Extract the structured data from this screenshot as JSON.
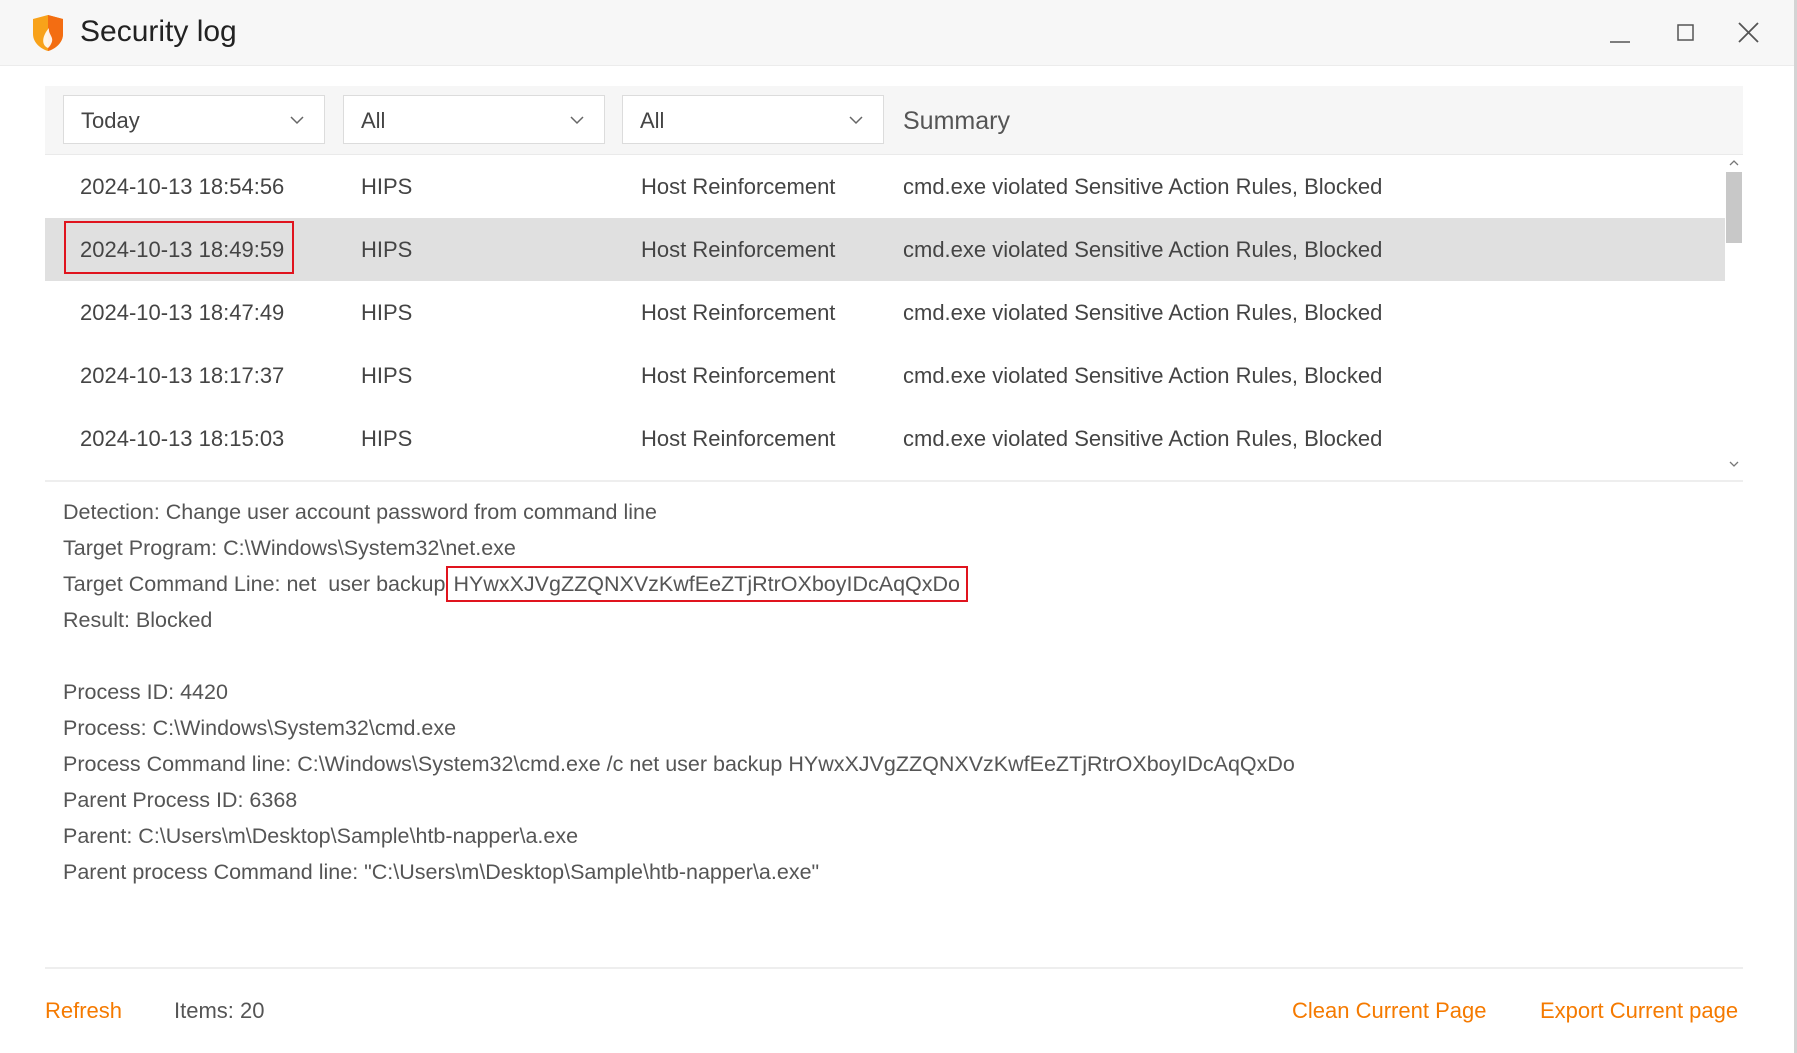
{
  "window": {
    "title": "Security log",
    "brand_color": "#f57a00"
  },
  "filters": [
    {
      "value": "Today"
    },
    {
      "value": "All"
    },
    {
      "value": "All"
    }
  ],
  "columns": {
    "summary": "Summary"
  },
  "rows": [
    {
      "time": "2024-10-13 18:54:56",
      "type": "HIPS",
      "category": "Host Reinforcement",
      "summary": "cmd.exe violated Sensitive Action Rules, Blocked"
    },
    {
      "time": "2024-10-13 18:49:59",
      "type": "HIPS",
      "category": "Host Reinforcement",
      "summary": "cmd.exe violated Sensitive Action Rules, Blocked",
      "selected": true
    },
    {
      "time": "2024-10-13 18:47:49",
      "type": "HIPS",
      "category": "Host Reinforcement",
      "summary": "cmd.exe violated Sensitive Action Rules, Blocked"
    },
    {
      "time": "2024-10-13 18:17:37",
      "type": "HIPS",
      "category": "Host Reinforcement",
      "summary": "cmd.exe violated Sensitive Action Rules, Blocked"
    },
    {
      "time": "2024-10-13 18:15:03",
      "type": "HIPS",
      "category": "Host Reinforcement",
      "summary": "cmd.exe violated Sensitive Action Rules, Blocked"
    }
  ],
  "details": {
    "detection": "Detection: Change user account password from command line",
    "target_program": "Target Program: C:\\Windows\\System32\\net.exe",
    "target_cmd_prefix": "Target Command Line: net  user backup",
    "target_cmd_password": "HYwxXJVgZZQNXVzKwfEeZTjRtrOXboyIDcAqQxDo",
    "result": "Result: Blocked",
    "pid": "Process ID: 4420",
    "process": "Process: C:\\Windows\\System32\\cmd.exe",
    "process_cmd": "Process Command line: C:\\Windows\\System32\\cmd.exe /c net user backup HYwxXJVgZZQNXVzKwfEeZTjRtrOXboyIDcAqQxDo",
    "ppid": "Parent Process ID: 6368",
    "parent": "Parent: C:\\Users\\m\\Desktop\\Sample\\htb-napper\\a.exe",
    "parent_cmd": "Parent process Command line: \"C:\\Users\\m\\Desktop\\Sample\\htb-napper\\a.exe\""
  },
  "footer": {
    "refresh": "Refresh",
    "items": "Items: 20",
    "clean": "Clean Current Page",
    "export": "Export Current page"
  }
}
